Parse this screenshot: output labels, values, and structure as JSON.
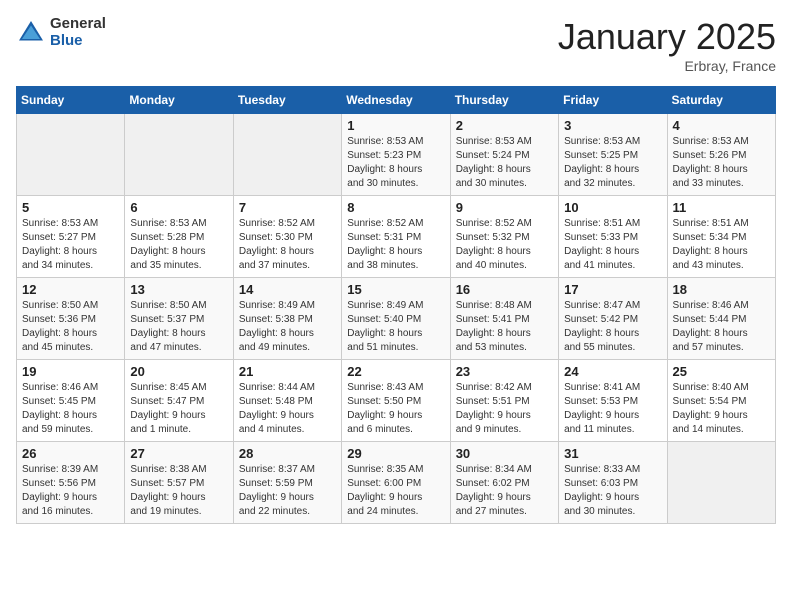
{
  "logo": {
    "general": "General",
    "blue": "Blue"
  },
  "title": "January 2025",
  "location": "Erbray, France",
  "days_header": [
    "Sunday",
    "Monday",
    "Tuesday",
    "Wednesday",
    "Thursday",
    "Friday",
    "Saturday"
  ],
  "weeks": [
    [
      {
        "day": "",
        "info": ""
      },
      {
        "day": "",
        "info": ""
      },
      {
        "day": "",
        "info": ""
      },
      {
        "day": "1",
        "info": "Sunrise: 8:53 AM\nSunset: 5:23 PM\nDaylight: 8 hours\nand 30 minutes."
      },
      {
        "day": "2",
        "info": "Sunrise: 8:53 AM\nSunset: 5:24 PM\nDaylight: 8 hours\nand 30 minutes."
      },
      {
        "day": "3",
        "info": "Sunrise: 8:53 AM\nSunset: 5:25 PM\nDaylight: 8 hours\nand 32 minutes."
      },
      {
        "day": "4",
        "info": "Sunrise: 8:53 AM\nSunset: 5:26 PM\nDaylight: 8 hours\nand 33 minutes."
      }
    ],
    [
      {
        "day": "5",
        "info": "Sunrise: 8:53 AM\nSunset: 5:27 PM\nDaylight: 8 hours\nand 34 minutes."
      },
      {
        "day": "6",
        "info": "Sunrise: 8:53 AM\nSunset: 5:28 PM\nDaylight: 8 hours\nand 35 minutes."
      },
      {
        "day": "7",
        "info": "Sunrise: 8:52 AM\nSunset: 5:30 PM\nDaylight: 8 hours\nand 37 minutes."
      },
      {
        "day": "8",
        "info": "Sunrise: 8:52 AM\nSunset: 5:31 PM\nDaylight: 8 hours\nand 38 minutes."
      },
      {
        "day": "9",
        "info": "Sunrise: 8:52 AM\nSunset: 5:32 PM\nDaylight: 8 hours\nand 40 minutes."
      },
      {
        "day": "10",
        "info": "Sunrise: 8:51 AM\nSunset: 5:33 PM\nDaylight: 8 hours\nand 41 minutes."
      },
      {
        "day": "11",
        "info": "Sunrise: 8:51 AM\nSunset: 5:34 PM\nDaylight: 8 hours\nand 43 minutes."
      }
    ],
    [
      {
        "day": "12",
        "info": "Sunrise: 8:50 AM\nSunset: 5:36 PM\nDaylight: 8 hours\nand 45 minutes."
      },
      {
        "day": "13",
        "info": "Sunrise: 8:50 AM\nSunset: 5:37 PM\nDaylight: 8 hours\nand 47 minutes."
      },
      {
        "day": "14",
        "info": "Sunrise: 8:49 AM\nSunset: 5:38 PM\nDaylight: 8 hours\nand 49 minutes."
      },
      {
        "day": "15",
        "info": "Sunrise: 8:49 AM\nSunset: 5:40 PM\nDaylight: 8 hours\nand 51 minutes."
      },
      {
        "day": "16",
        "info": "Sunrise: 8:48 AM\nSunset: 5:41 PM\nDaylight: 8 hours\nand 53 minutes."
      },
      {
        "day": "17",
        "info": "Sunrise: 8:47 AM\nSunset: 5:42 PM\nDaylight: 8 hours\nand 55 minutes."
      },
      {
        "day": "18",
        "info": "Sunrise: 8:46 AM\nSunset: 5:44 PM\nDaylight: 8 hours\nand 57 minutes."
      }
    ],
    [
      {
        "day": "19",
        "info": "Sunrise: 8:46 AM\nSunset: 5:45 PM\nDaylight: 8 hours\nand 59 minutes."
      },
      {
        "day": "20",
        "info": "Sunrise: 8:45 AM\nSunset: 5:47 PM\nDaylight: 9 hours\nand 1 minute."
      },
      {
        "day": "21",
        "info": "Sunrise: 8:44 AM\nSunset: 5:48 PM\nDaylight: 9 hours\nand 4 minutes."
      },
      {
        "day": "22",
        "info": "Sunrise: 8:43 AM\nSunset: 5:50 PM\nDaylight: 9 hours\nand 6 minutes."
      },
      {
        "day": "23",
        "info": "Sunrise: 8:42 AM\nSunset: 5:51 PM\nDaylight: 9 hours\nand 9 minutes."
      },
      {
        "day": "24",
        "info": "Sunrise: 8:41 AM\nSunset: 5:53 PM\nDaylight: 9 hours\nand 11 minutes."
      },
      {
        "day": "25",
        "info": "Sunrise: 8:40 AM\nSunset: 5:54 PM\nDaylight: 9 hours\nand 14 minutes."
      }
    ],
    [
      {
        "day": "26",
        "info": "Sunrise: 8:39 AM\nSunset: 5:56 PM\nDaylight: 9 hours\nand 16 minutes."
      },
      {
        "day": "27",
        "info": "Sunrise: 8:38 AM\nSunset: 5:57 PM\nDaylight: 9 hours\nand 19 minutes."
      },
      {
        "day": "28",
        "info": "Sunrise: 8:37 AM\nSunset: 5:59 PM\nDaylight: 9 hours\nand 22 minutes."
      },
      {
        "day": "29",
        "info": "Sunrise: 8:35 AM\nSunset: 6:00 PM\nDaylight: 9 hours\nand 24 minutes."
      },
      {
        "day": "30",
        "info": "Sunrise: 8:34 AM\nSunset: 6:02 PM\nDaylight: 9 hours\nand 27 minutes."
      },
      {
        "day": "31",
        "info": "Sunrise: 8:33 AM\nSunset: 6:03 PM\nDaylight: 9 hours\nand 30 minutes."
      },
      {
        "day": "",
        "info": ""
      }
    ]
  ]
}
